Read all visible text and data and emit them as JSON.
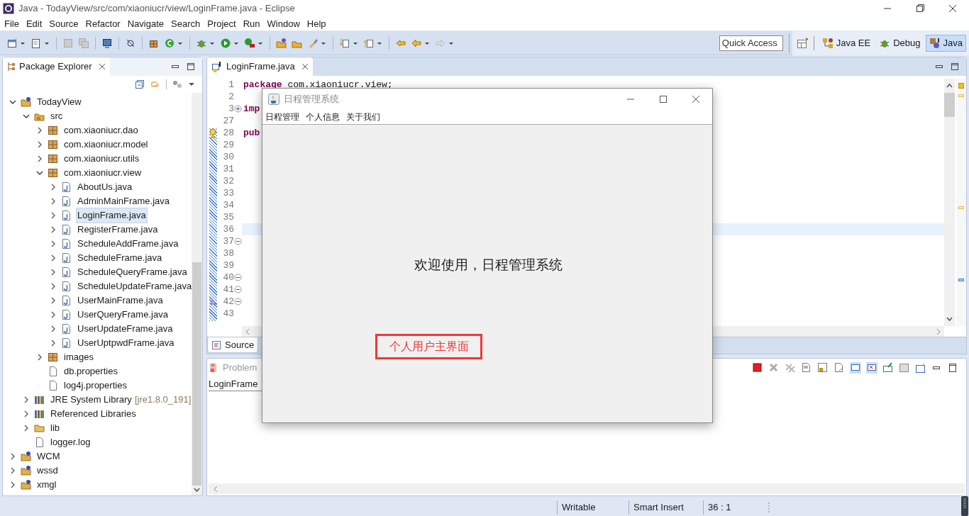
{
  "window": {
    "title": "Java - TodayView/src/com/xiaoniucr/view/LoginFrame.java - Eclipse"
  },
  "menu": [
    "File",
    "Edit",
    "Source",
    "Refactor",
    "Navigate",
    "Search",
    "Project",
    "Run",
    "Window",
    "Help"
  ],
  "quick_access": {
    "placeholder": "Quick Access"
  },
  "perspectives": [
    {
      "label": "Java EE",
      "kind": "javaee",
      "selected": false
    },
    {
      "label": "Debug",
      "kind": "debug",
      "selected": false
    },
    {
      "label": "Java",
      "kind": "java",
      "selected": true
    }
  ],
  "package_explorer": {
    "title": "Package Explorer",
    "tree": [
      {
        "label": "TodayView",
        "kind": "project",
        "expanded": true,
        "selected": false,
        "children": [
          {
            "label": "src",
            "kind": "source-folder",
            "expanded": true,
            "selected": false,
            "children": [
              {
                "label": "com.xiaoniucr.dao",
                "kind": "package",
                "expanded": false,
                "selected": false
              },
              {
                "label": "com.xiaoniucr.model",
                "kind": "package",
                "expanded": false,
                "selected": false
              },
              {
                "label": "com.xiaoniucr.utils",
                "kind": "package",
                "expanded": false,
                "selected": false
              },
              {
                "label": "com.xiaoniucr.view",
                "kind": "package",
                "expanded": true,
                "selected": false,
                "children": [
                  {
                    "label": "AboutUs.java",
                    "kind": "java-file",
                    "expanded": false,
                    "selected": false
                  },
                  {
                    "label": "AdminMainFrame.java",
                    "kind": "java-file",
                    "expanded": false,
                    "selected": false
                  },
                  {
                    "label": "LoginFrame.java",
                    "kind": "java-file",
                    "expanded": false,
                    "selected": true
                  },
                  {
                    "label": "RegisterFrame.java",
                    "kind": "java-file",
                    "expanded": false,
                    "selected": false
                  },
                  {
                    "label": "ScheduleAddFrame.java",
                    "kind": "java-file",
                    "expanded": false,
                    "selected": false
                  },
                  {
                    "label": "ScheduleFrame.java",
                    "kind": "java-file",
                    "expanded": false,
                    "selected": false
                  },
                  {
                    "label": "ScheduleQueryFrame.java",
                    "kind": "java-file",
                    "expanded": false,
                    "selected": false
                  },
                  {
                    "label": "ScheduleUpdateFrame.java",
                    "kind": "java-file",
                    "expanded": false,
                    "selected": false
                  },
                  {
                    "label": "UserMainFrame.java",
                    "kind": "java-file",
                    "expanded": false,
                    "selected": false
                  },
                  {
                    "label": "UserQueryFrame.java",
                    "kind": "java-file",
                    "expanded": false,
                    "selected": false
                  },
                  {
                    "label": "UserUpdateFrame.java",
                    "kind": "java-file",
                    "expanded": false,
                    "selected": false
                  },
                  {
                    "label": "UserUptpwdFrame.java",
                    "kind": "java-file",
                    "expanded": false,
                    "selected": false
                  }
                ]
              },
              {
                "label": "images",
                "kind": "package",
                "expanded": false,
                "selected": false
              },
              {
                "label": "db.properties",
                "kind": "file",
                "selected": false
              },
              {
                "label": "log4j.properties",
                "kind": "file",
                "selected": false
              }
            ]
          },
          {
            "label": "JRE System Library",
            "decoration": "[jre1.8.0_191]",
            "kind": "library",
            "expanded": false,
            "selected": false
          },
          {
            "label": "Referenced Libraries",
            "kind": "library",
            "expanded": false,
            "selected": false
          },
          {
            "label": "lib",
            "kind": "folder",
            "expanded": false,
            "selected": false
          },
          {
            "label": "logger.log",
            "kind": "file",
            "selected": false
          }
        ]
      },
      {
        "label": "WCM",
        "kind": "project",
        "expanded": false,
        "selected": false
      },
      {
        "label": "wssd",
        "kind": "project",
        "expanded": false,
        "selected": false
      },
      {
        "label": "xmgl",
        "kind": "project",
        "expanded": false,
        "selected": false
      }
    ]
  },
  "editor": {
    "tab": "LoginFrame.java",
    "bottom_tab": "Source",
    "lines": [
      {
        "number": "1",
        "keyword": "package",
        "text": " com.xiaoniucr.view;",
        "current": false
      },
      {
        "number": "2",
        "current": false
      },
      {
        "number": "3",
        "keyword": "imp",
        "folded": true,
        "current": false
      },
      {
        "number": "27",
        "current": false
      },
      {
        "number": "28",
        "keyword": "pub",
        "warning": true,
        "current": false
      },
      {
        "number": "29",
        "current": false
      },
      {
        "number": "30",
        "current": false
      },
      {
        "number": "31",
        "current": false
      },
      {
        "number": "32",
        "current": false
      },
      {
        "number": "33",
        "current": false
      },
      {
        "number": "34",
        "current": false
      },
      {
        "number": "35",
        "current": false
      },
      {
        "number": "36",
        "current": true
      },
      {
        "number": "37",
        "folded": false,
        "current": false
      },
      {
        "number": "38",
        "current": false
      },
      {
        "number": "39",
        "current": false
      },
      {
        "number": "40",
        "folded": false,
        "current": false
      },
      {
        "number": "41",
        "folded": false,
        "current": false
      },
      {
        "number": "42",
        "folded": false,
        "override": true,
        "current": false
      },
      {
        "number": "43",
        "current": false
      }
    ]
  },
  "problems": {
    "tab": "Problem",
    "column_1": "LoginFrame"
  },
  "app_window": {
    "title": "日程管理系统",
    "menu": [
      "日程管理",
      "个人信息",
      "关于我们"
    ],
    "welcome": "欢迎使用，日程管理系统",
    "label": "个人用户主界面"
  },
  "status_bar": [
    "Writable",
    "Smart Insert",
    "36 : 1"
  ]
}
